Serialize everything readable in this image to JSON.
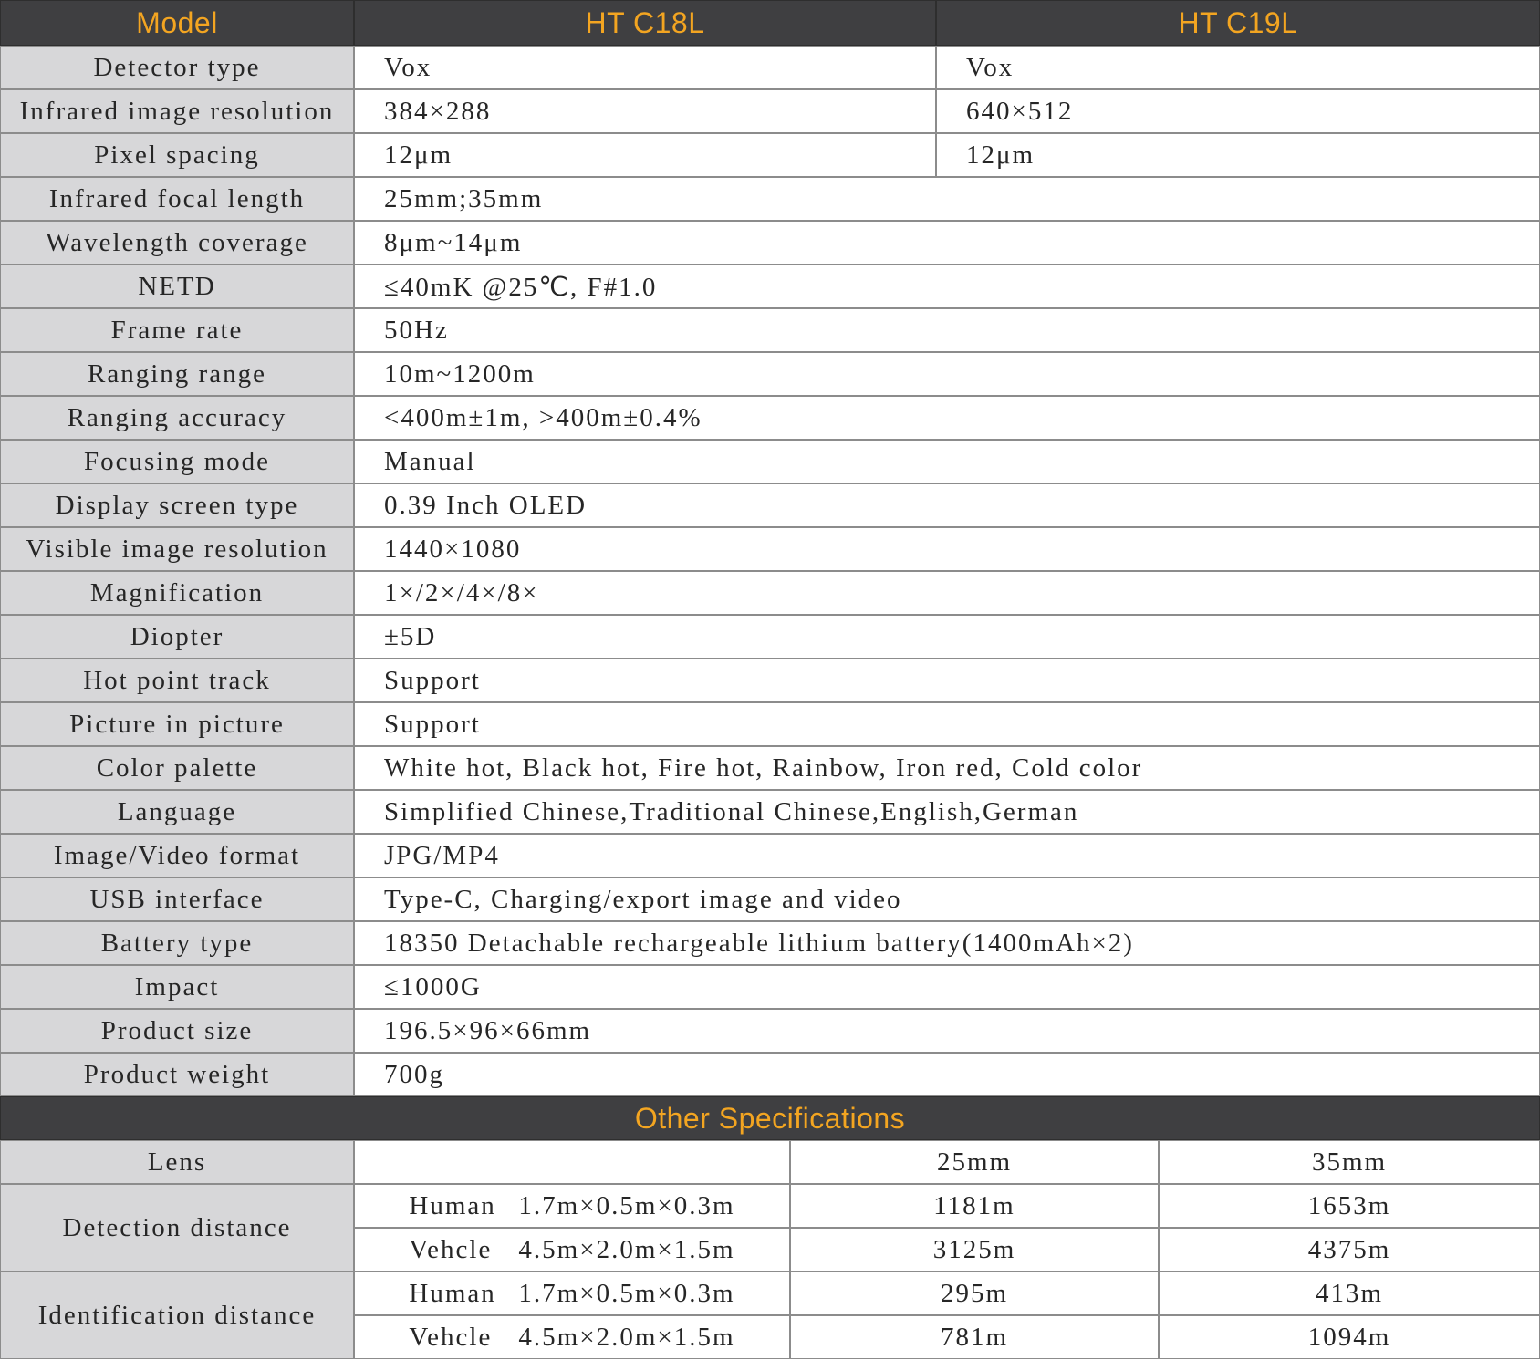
{
  "header": {
    "model_label": "Model",
    "models": [
      "HT C18L",
      "HT C19L"
    ]
  },
  "rows": [
    {
      "label": "Detector   type",
      "c18l": "Vox",
      "c19l": "Vox"
    },
    {
      "label": "Infrared image resolution",
      "c18l": "384×288",
      "c19l": "640×512"
    },
    {
      "label": "Pixel spacing",
      "c18l": "12μm",
      "c19l": "12μm"
    },
    {
      "label": "Infrared focal length",
      "value": "25mm;35mm"
    },
    {
      "label": "Wavelength coverage",
      "value": "8μm~14μm"
    },
    {
      "label": "NETD",
      "value": "≤40mK @25℃, F#1.0"
    },
    {
      "label": "Frame rate",
      "value": "50Hz"
    },
    {
      "label": "Ranging range",
      "value": "10m~1200m"
    },
    {
      "label": "Ranging accuracy",
      "value": "<400m±1m, >400m±0.4%"
    },
    {
      "label": "Focusing mode",
      "value": "Manual"
    },
    {
      "label": "Display screen type",
      "value": "0.39 Inch OLED"
    },
    {
      "label": "Visible image resolution",
      "value": "1440×1080"
    },
    {
      "label": "Magnification",
      "value": "1×/2×/4×/8×"
    },
    {
      "label": "Diopter",
      "value": "±5D"
    },
    {
      "label": "Hot point track",
      "value": "Support"
    },
    {
      "label": "Picture in picture",
      "value": "Support"
    },
    {
      "label": "Color palette",
      "value": "White hot, Black hot, Fire hot, Rainbow, Iron red, Cold color"
    },
    {
      "label": "Language",
      "value": "Simplified Chinese,Traditional Chinese,English,German"
    },
    {
      "label": "Image/Video format",
      "value": "JPG/MP4"
    },
    {
      "label": "USB interface",
      "value": "Type-C, Charging/export image and video"
    },
    {
      "label": "Battery type",
      "value": "18350 Detachable rechargeable lithium battery(1400mAh×2)"
    },
    {
      "label": "Impact",
      "value": "≤1000G"
    },
    {
      "label": "Product size",
      "value": "196.5×96×66mm"
    },
    {
      "label": "Product weight",
      "value": "700g"
    }
  ],
  "other": {
    "title": "Other Specifications",
    "lens_label": "Lens",
    "lenses": [
      "25mm",
      "35mm"
    ],
    "groups": [
      {
        "label": "Detection distance",
        "targets": [
          {
            "name": "Human",
            "size": "1.7m×0.5m×0.3m",
            "values": [
              "1181m",
              "1653m"
            ]
          },
          {
            "name": "Vehcle",
            "size": "4.5m×2.0m×1.5m",
            "values": [
              "3125m",
              "4375m"
            ]
          }
        ]
      },
      {
        "label": "Identification distance",
        "targets": [
          {
            "name": "Human",
            "size": "1.7m×0.5m×0.3m",
            "values": [
              "295m",
              "413m"
            ]
          },
          {
            "name": "Vehcle",
            "size": "4.5m×2.0m×1.5m",
            "values": [
              "781m",
              "1094m"
            ]
          }
        ]
      }
    ]
  }
}
